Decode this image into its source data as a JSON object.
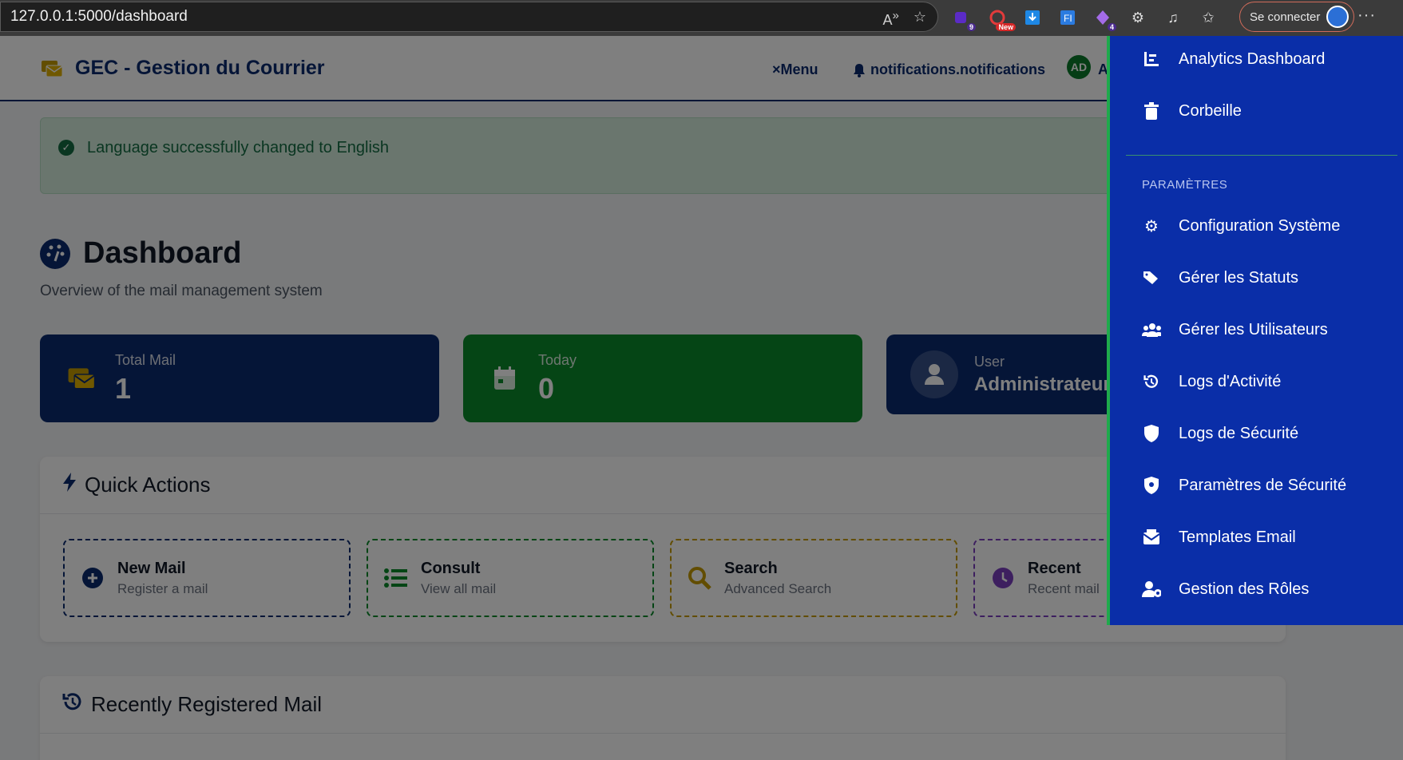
{
  "browser": {
    "url": "127.0.0.1:5000/dashboard",
    "signin_label": "Se connecter",
    "ext_badges": {
      "a": "9",
      "b": "New",
      "c": "4"
    },
    "more_label": "···"
  },
  "header": {
    "title": "GEC - Gestion du Courrier",
    "menu_label": "Menu",
    "menu_close": "×",
    "notifications_label": "notifications.notifications",
    "avatar_initials": "AD",
    "user_initial": "A"
  },
  "alert": {
    "text": "Language successfully changed to English"
  },
  "dashboard": {
    "title": "Dashboard",
    "subtitle": "Overview of the mail management system"
  },
  "stats": [
    {
      "label": "Total Mail",
      "value": "1"
    },
    {
      "label": "Today",
      "value": "0"
    },
    {
      "label": "User",
      "value": "Administrateur"
    }
  ],
  "quick_actions": {
    "title": "Quick Actions",
    "items": [
      {
        "title": "New Mail",
        "subtitle": "Register a mail",
        "icon": "plus-circle-icon"
      },
      {
        "title": "Consult",
        "subtitle": "View all mail",
        "icon": "list-icon"
      },
      {
        "title": "Search",
        "subtitle": "Advanced Search",
        "icon": "search-icon"
      },
      {
        "title": "Recent",
        "subtitle": "Recent mail",
        "icon": "clock-icon"
      }
    ]
  },
  "recent": {
    "title": "Recently Registered Mail"
  },
  "side_menu": {
    "items_top": [
      {
        "label": "Analytics Dashboard",
        "icon": "chart-icon"
      },
      {
        "label": "Corbeille",
        "icon": "trash-icon"
      }
    ],
    "section_label": "PARAMÈTRES",
    "items_settings": [
      {
        "label": "Configuration Système",
        "icon": "gear-icon"
      },
      {
        "label": "Gérer les Statuts",
        "icon": "tags-icon"
      },
      {
        "label": "Gérer les Utilisateurs",
        "icon": "users-icon"
      },
      {
        "label": "Logs d'Activité",
        "icon": "history-icon"
      },
      {
        "label": "Logs de Sécurité",
        "icon": "shield-icon"
      },
      {
        "label": "Paramètres de Sécurité",
        "icon": "shield-cog-icon"
      },
      {
        "label": "Templates Email",
        "icon": "envelope-icon"
      },
      {
        "label": "Gestion des Rôles",
        "icon": "user-role-icon"
      }
    ]
  },
  "colors": {
    "primary": "#0b2a6f",
    "success": "#0b8a2b",
    "warning": "#c49a00",
    "purple": "#7b3fbf",
    "menu_bg": "#0a2ea8",
    "menu_border": "#1faa4b"
  }
}
